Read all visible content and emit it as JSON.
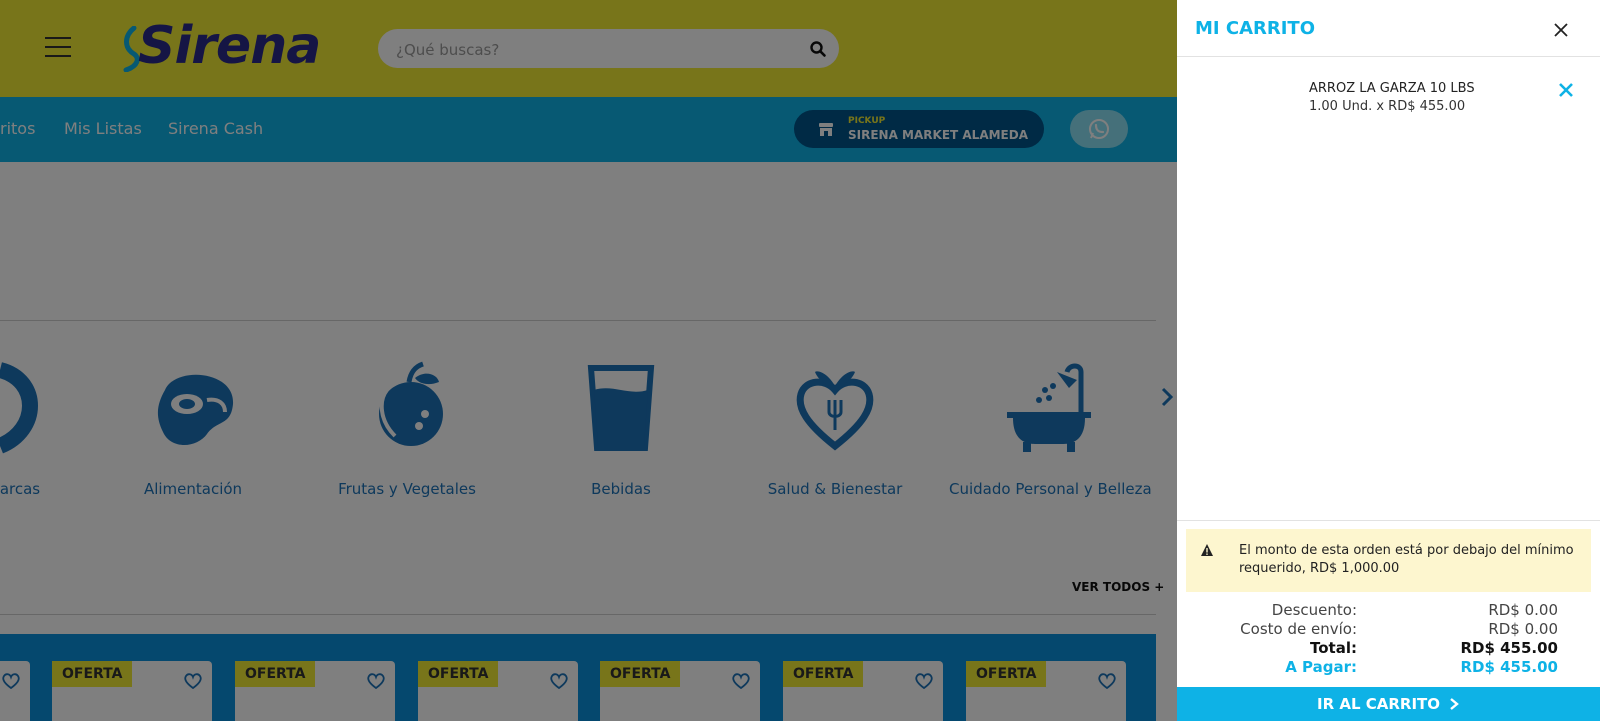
{
  "header": {
    "logo_text": "Sirena",
    "search_placeholder": "¿Qué buscas?"
  },
  "nav": {
    "links": [
      "ritos",
      "Mis Listas",
      "Sirena Cash"
    ],
    "pickup_label": "PICKUP",
    "pickup_store": "SIRENA MARKET ALAMEDA"
  },
  "categories": [
    {
      "label": "arcas",
      "icon": "brands-icon"
    },
    {
      "label": "Alimentación",
      "icon": "meat-steak-icon"
    },
    {
      "label": "Frutas y Vegetales",
      "icon": "fruit-icon"
    },
    {
      "label": "Bebidas",
      "icon": "glass-icon"
    },
    {
      "label": "Salud & Bienestar",
      "icon": "heart-apple-icon"
    },
    {
      "label": "Cuidado Personal y Belleza",
      "icon": "bathtub-icon"
    }
  ],
  "ver_todos": "VER TODOS +",
  "promo": {
    "badge": "OFERTA"
  },
  "cart": {
    "title": "MI CARRITO",
    "items": [
      {
        "name": "ARROZ LA GARZA 10 LBS",
        "qty_price": "1.00 Und. x RD$ 455.00"
      }
    ],
    "warning": "El monto de esta orden está por debajo del mínimo requerido, RD$ 1,000.00",
    "summary": {
      "discount_label": "Descuento:",
      "discount_value": "RD$ 0.00",
      "shipping_label": "Costo de envío:",
      "shipping_value": "RD$ 0.00",
      "total_label": "Total:",
      "total_value": "RD$ 455.00",
      "pay_label": "A Pagar:",
      "pay_value": "RD$ 455.00"
    },
    "button_label": "IR AL CARRITO"
  },
  "colors": {
    "yellow": "#f0ea35",
    "cyan": "#0eb2e6",
    "navy": "#00558a",
    "icon_blue": "#1c72b8"
  }
}
